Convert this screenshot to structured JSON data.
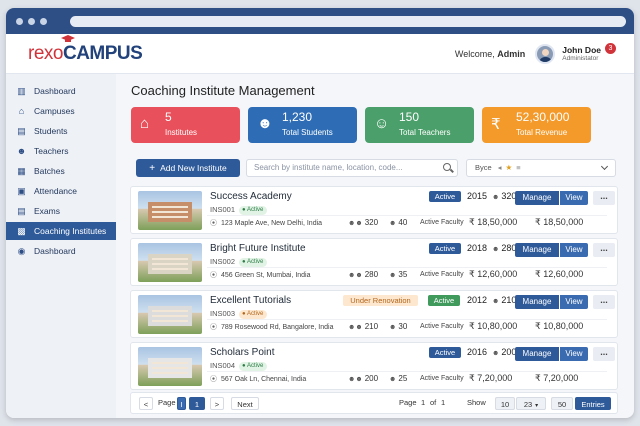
{
  "header": {
    "logo_part1": "rexo",
    "logo_part2": "CAMPUS",
    "welcome_prefix": "Welcome, ",
    "welcome_name": "Admin",
    "user_name": "John Doe",
    "user_role": "Administator",
    "notification_count": "3"
  },
  "sidebar": {
    "items": [
      {
        "label": "Dashboard",
        "icon": "chart-icon"
      },
      {
        "label": "Campuses",
        "icon": "campus-icon"
      },
      {
        "label": "Students",
        "icon": "students-icon"
      },
      {
        "label": "Teachers",
        "icon": "teachers-icon"
      },
      {
        "label": "Batches",
        "icon": "batches-icon"
      },
      {
        "label": "Attendance",
        "icon": "attendance-icon"
      },
      {
        "label": "Exams",
        "icon": "exams-icon"
      },
      {
        "label": "Coaching Institutes",
        "icon": "institute-icon",
        "active": true
      },
      {
        "label": "Dashboard",
        "icon": "dashboard-icon"
      }
    ]
  },
  "page": {
    "title": "Coaching Institute Management"
  },
  "stats": [
    {
      "value": "5",
      "label": "Institutes",
      "color": "#e8505b"
    },
    {
      "value": "1,230",
      "label": "Total Students",
      "color": "#2e6db5"
    },
    {
      "value": "150",
      "label": "Total Teachers",
      "color": "#4a9f6a"
    },
    {
      "value": "52,30,000",
      "label": "Total Revenue",
      "color": "#f39a2a"
    }
  ],
  "toolbar": {
    "add_label": "Add New Institute",
    "search_placeholder": "Search by institute name, location, code...",
    "filter_label": "Byce"
  },
  "institutes": [
    {
      "name": "Success Academy",
      "code": "INS001",
      "tag": "Active",
      "address": "123 Maple Ave, New Delhi, India",
      "status": "Active",
      "year": "2015",
      "count": "320",
      "students": "320",
      "teachers": "40",
      "faculty_label": "Active Faculty",
      "fee": "₹ 18,50,000",
      "revenue": "₹ 18,50,000"
    },
    {
      "name": "Bright Future Institute",
      "code": "INS002",
      "tag": "Active",
      "address": "456 Green St, Mumbai, India",
      "status": "Active",
      "year": "2018",
      "count": "280",
      "students": "280",
      "teachers": "35",
      "faculty_label": "Active Faculty",
      "fee": "₹ 12,60,000",
      "revenue": "₹ 12,60,000"
    },
    {
      "name": "Excellent Tutorials",
      "code": "INS003",
      "tag": "Active",
      "address": "789 Rosewood Rd, Bangalore, India",
      "status": "Active",
      "renovation": "Under Renovation",
      "year": "2012",
      "count": "210",
      "students": "210",
      "teachers": "30",
      "faculty_label": "Active Faculty",
      "fee": "₹ 10,80,000",
      "revenue": "₹ 10,80,000"
    },
    {
      "name": "Scholars Point",
      "code": "INS004",
      "tag": "Active",
      "address": "567 Oak Ln, Chennai, India",
      "status": "Active",
      "year": "2016",
      "count": "200",
      "students": "200",
      "teachers": "25",
      "faculty_label": "Active Faculty",
      "fee": "₹ 7,20,000",
      "revenue": "₹ 7,20,000"
    }
  ],
  "row_actions": {
    "manage": "Manage",
    "view": "View",
    "more": "..."
  },
  "pagination": {
    "prev": "<",
    "page_label": "Page",
    "page_input": "I",
    "page_current": "1",
    "next": ">",
    "next_label": "Next",
    "page_of_label": "Page",
    "page_num": "1",
    "of_label": "of",
    "page_total": "1",
    "show_label": "Show",
    "opt1": "10",
    "opt2": "23",
    "opt3": "50",
    "entries_label": "Entries"
  }
}
